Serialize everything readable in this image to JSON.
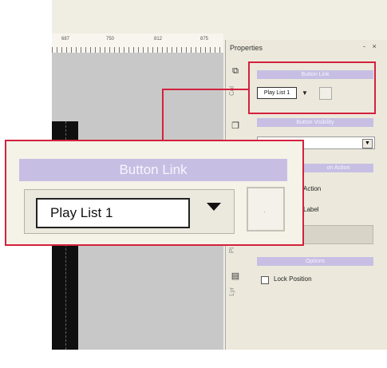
{
  "ruler": {
    "labels": [
      "687",
      "750",
      "812",
      "875"
    ]
  },
  "properties": {
    "title": "Properties",
    "window_buttons": "- ×",
    "tabs": [
      "Col",
      "Pl",
      "Lyr"
    ],
    "button_link": {
      "header": "Button Link",
      "value": "Play List 1"
    },
    "button_visibility": {
      "header": "Button Visibility"
    },
    "button_action": {
      "header": "Button Action",
      "partial": "on Action",
      "items": [
        "Action",
        "Label"
      ]
    },
    "options": {
      "header": "Options",
      "lock_position": "Lock Position"
    }
  },
  "zoom": {
    "header": "Button Link",
    "value": "Play List 1"
  },
  "colors": {
    "highlight": "#d4213d",
    "header": "#c7bfe3"
  }
}
